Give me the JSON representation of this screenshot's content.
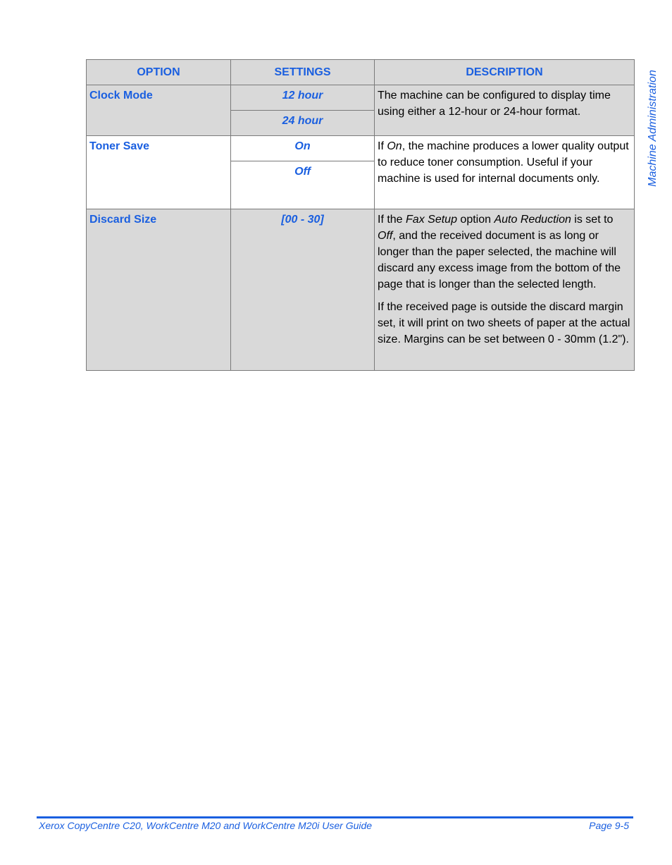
{
  "side_tab": {
    "label": "Machine Administration"
  },
  "table": {
    "headers": [
      "OPTION",
      "SETTINGS",
      "DESCRIPTION"
    ],
    "rows": [
      {
        "option": "Clock Mode",
        "settings": [
          "12 hour",
          "24 hour"
        ],
        "description": [
          "The machine can be configured to display time using either a 12-hour or 24-hour format."
        ]
      },
      {
        "option": "Toner Save",
        "settings": [
          "On",
          "Off"
        ],
        "description_parts": {
          "pre": "If ",
          "em": "On",
          "post": ", the machine produces a lower quality output to reduce toner consumption. Useful if your machine is used for internal documents only."
        }
      },
      {
        "option": "Discard Size",
        "settings": [
          "[00 - 30]"
        ],
        "description_parts": {
          "p1_a": "If the ",
          "p1_em1": "Fax Setup",
          "p1_b": " option ",
          "p1_em2": "Auto Reduction",
          "p1_c": " is set to ",
          "p1_em3": "Off",
          "p1_d": ", and the received document is as long or longer than the paper selected, the machine will discard any excess image from the bottom of the page that is longer than the selected length.",
          "p2": "If the received page is outside the discard margin set, it will print on two sheets of paper at the actual size. Margins can be set between 0 - 30mm (1.2\")."
        }
      }
    ]
  },
  "footer": {
    "guide_title": "Xerox CopyCentre C20, WorkCentre M20 and WorkCentre M20i User Guide",
    "page_number": "Page 9-5"
  },
  "colors": {
    "accent": "#1a5fe0",
    "shaded_row": "#d9d9d9",
    "border": "#7a7a7a"
  }
}
